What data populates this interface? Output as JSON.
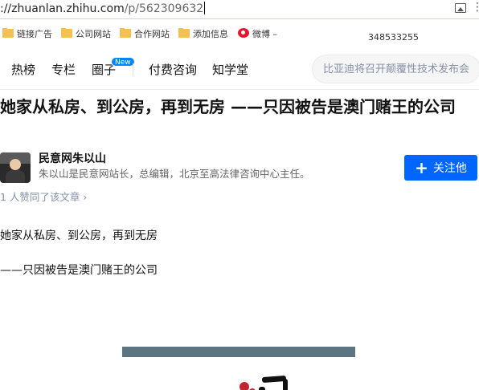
{
  "browser": {
    "url_host": "zhuanlan.zhihu.com",
    "url_path": "/p/562309632",
    "url_scheme": "://"
  },
  "bookmarks": {
    "items": [
      {
        "label": "链接广告",
        "icon": "folder-icon"
      },
      {
        "label": "公司网站",
        "icon": "folder-icon"
      },
      {
        "label": "合作网站",
        "icon": "folder-icon"
      },
      {
        "label": "添加信息",
        "icon": "folder-icon"
      },
      {
        "label": "微博 –",
        "icon": "weibo-icon"
      }
    ],
    "extra_text": "348533255"
  },
  "nav": {
    "links": [
      "热榜",
      "专栏",
      "圈子",
      "付费咨询",
      "知学堂"
    ],
    "new_badge": "New",
    "search_placeholder": "比亚迪将召开颠覆性技术发布会"
  },
  "article": {
    "title": "她家从私房、到公房，再到无房 ——只因被告是澳门赌王的公司",
    "author_name": "民意网朱以山",
    "author_bio": "朱以山是民意网站长，总编辑，北京至高法律咨询中心主任。",
    "follow_label": "关注他",
    "follow_plus": "+",
    "likes_text": "1 人赞同了该文章 ›",
    "paragraphs": [
      "她家从私房、到公房，再到无房",
      "——只因被告是澳门赌王的公司"
    ]
  },
  "colors": {
    "accent": "#0066ff",
    "new_badge": "#0084ff",
    "muted": "#8590a6"
  }
}
